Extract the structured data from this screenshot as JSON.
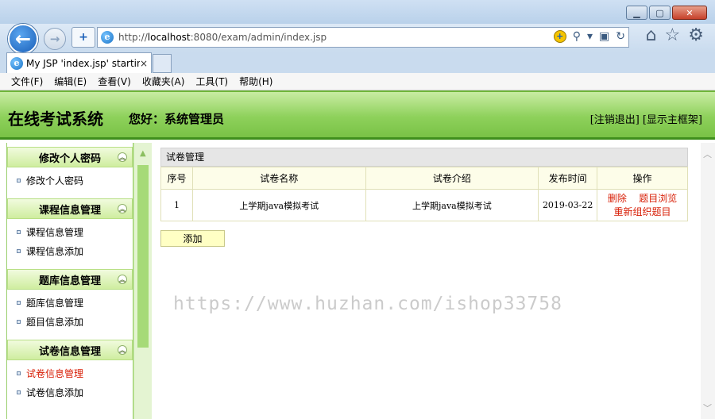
{
  "browser": {
    "address": "http://localhost:8080/exam/admin/index.jsp",
    "address_host": "localhost",
    "address_prefix": "http://",
    "address_suffix": ":8080/exam/admin/index.jsp",
    "tab_title": "My JSP 'index.jsp' startin...",
    "tab_close": "×",
    "menu": [
      "文件(F)",
      "编辑(E)",
      "查看(V)",
      "收藏夹(A)",
      "工具(T)",
      "帮助(H)"
    ]
  },
  "header": {
    "system_title": "在线考试系统",
    "greeting": "您好：系统管理员",
    "logout": "[注销退出]",
    "show_frame": "[显示主框架]"
  },
  "sidebar": {
    "groups": [
      {
        "title": "修改个人密码",
        "items": [
          "修改个人密码"
        ]
      },
      {
        "title": "课程信息管理",
        "items": [
          "课程信息管理",
          "课程信息添加"
        ]
      },
      {
        "title": "题库信息管理",
        "items": [
          "题库信息管理",
          "题目信息添加"
        ]
      },
      {
        "title": "试卷信息管理",
        "items": [
          "试卷信息管理",
          "试卷信息添加"
        ]
      }
    ],
    "active_item": "试卷信息管理"
  },
  "main": {
    "panel_title": "试卷管理",
    "columns": [
      "序号",
      "试卷名称",
      "试卷介绍",
      "发布时间",
      "操作"
    ],
    "rows": [
      {
        "index": "1",
        "name": "上学期java模拟考试",
        "intro": "上学期java模拟考试",
        "date": "2019-03-22",
        "ops": [
          "删除",
          "题目浏览",
          "重新组织题目"
        ]
      }
    ],
    "add_button": "添加"
  },
  "watermark": "https://www.huzhan.com/ishop33758"
}
